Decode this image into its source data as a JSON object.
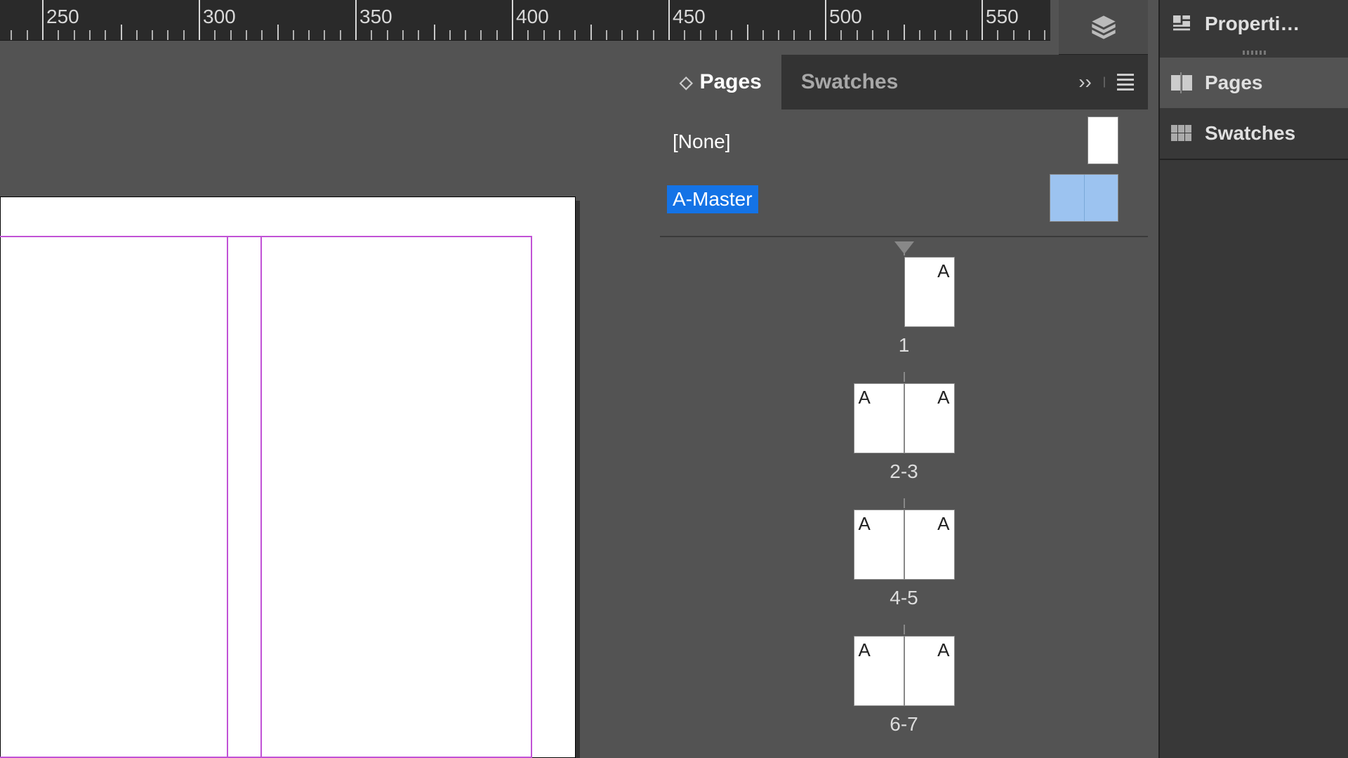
{
  "ruler": {
    "start": 250,
    "ticks": [
      250,
      300,
      350,
      400,
      450,
      500,
      550
    ]
  },
  "panel": {
    "tabs": {
      "pages": "Pages",
      "swatches": "Swatches"
    },
    "masters": {
      "none": "[None]",
      "amaster": "A-Master"
    },
    "spreads": [
      {
        "label": "1",
        "pages": [
          "right"
        ],
        "badge": "A"
      },
      {
        "label": "2-3",
        "pages": [
          "left",
          "right"
        ],
        "badge": "A"
      },
      {
        "label": "4-5",
        "pages": [
          "left",
          "right"
        ],
        "badge": "A"
      },
      {
        "label": "6-7",
        "pages": [
          "left",
          "right"
        ],
        "badge": "A"
      }
    ]
  },
  "dock": {
    "properties": "Properti…",
    "pages": "Pages",
    "swatches": "Swatches"
  }
}
